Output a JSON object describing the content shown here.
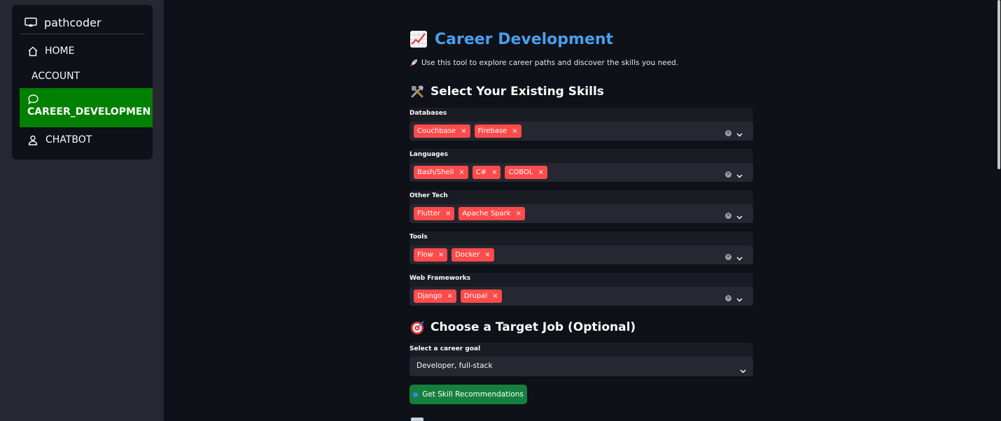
{
  "sidebar": {
    "brand": "pathcoder",
    "items": [
      {
        "label": "HOME",
        "icon": "home-icon"
      },
      {
        "label": "ACCOUNT"
      },
      {
        "label": "CAREER_DEVELOPMEN",
        "icon": "chat-bubble-icon",
        "active": true
      },
      {
        "label": "CHATBOT",
        "icon": "person-icon"
      }
    ]
  },
  "main": {
    "title": "Career Development",
    "title_icon": "chart-increasing-icon",
    "intro": "Use this tool to explore career paths and discover the skills you need.",
    "intro_icon": "rocket-icon",
    "skills_heading": "Select Your Existing Skills",
    "skills_heading_icon": "hammer-wrench-icon",
    "skill_groups": [
      {
        "label": "Databases",
        "tags": [
          "Couchbase",
          "Firebase"
        ]
      },
      {
        "label": "Languages",
        "tags": [
          "Bash/Shell",
          "C#",
          "COBOL"
        ]
      },
      {
        "label": "Other Tech",
        "tags": [
          "Flutter",
          "Apache Spark"
        ]
      },
      {
        "label": "Tools",
        "tags": [
          "Flow",
          "Docker"
        ]
      },
      {
        "label": "Web Frameworks",
        "tags": [
          "Django",
          "Drupal"
        ]
      }
    ],
    "target_heading": "Choose a Target Job (Optional)",
    "target_heading_icon": "target-icon",
    "select_label": "Select a career goal",
    "select_value": "Developer, full-stack",
    "button_label": "Get Skill Recommendations"
  },
  "colors": {
    "accent_title": "#4a9eee",
    "active_nav": "#008000",
    "tag": "#ff4b4b",
    "button": "#15803d",
    "background": "#0e1117",
    "sidebar": "#262730"
  }
}
